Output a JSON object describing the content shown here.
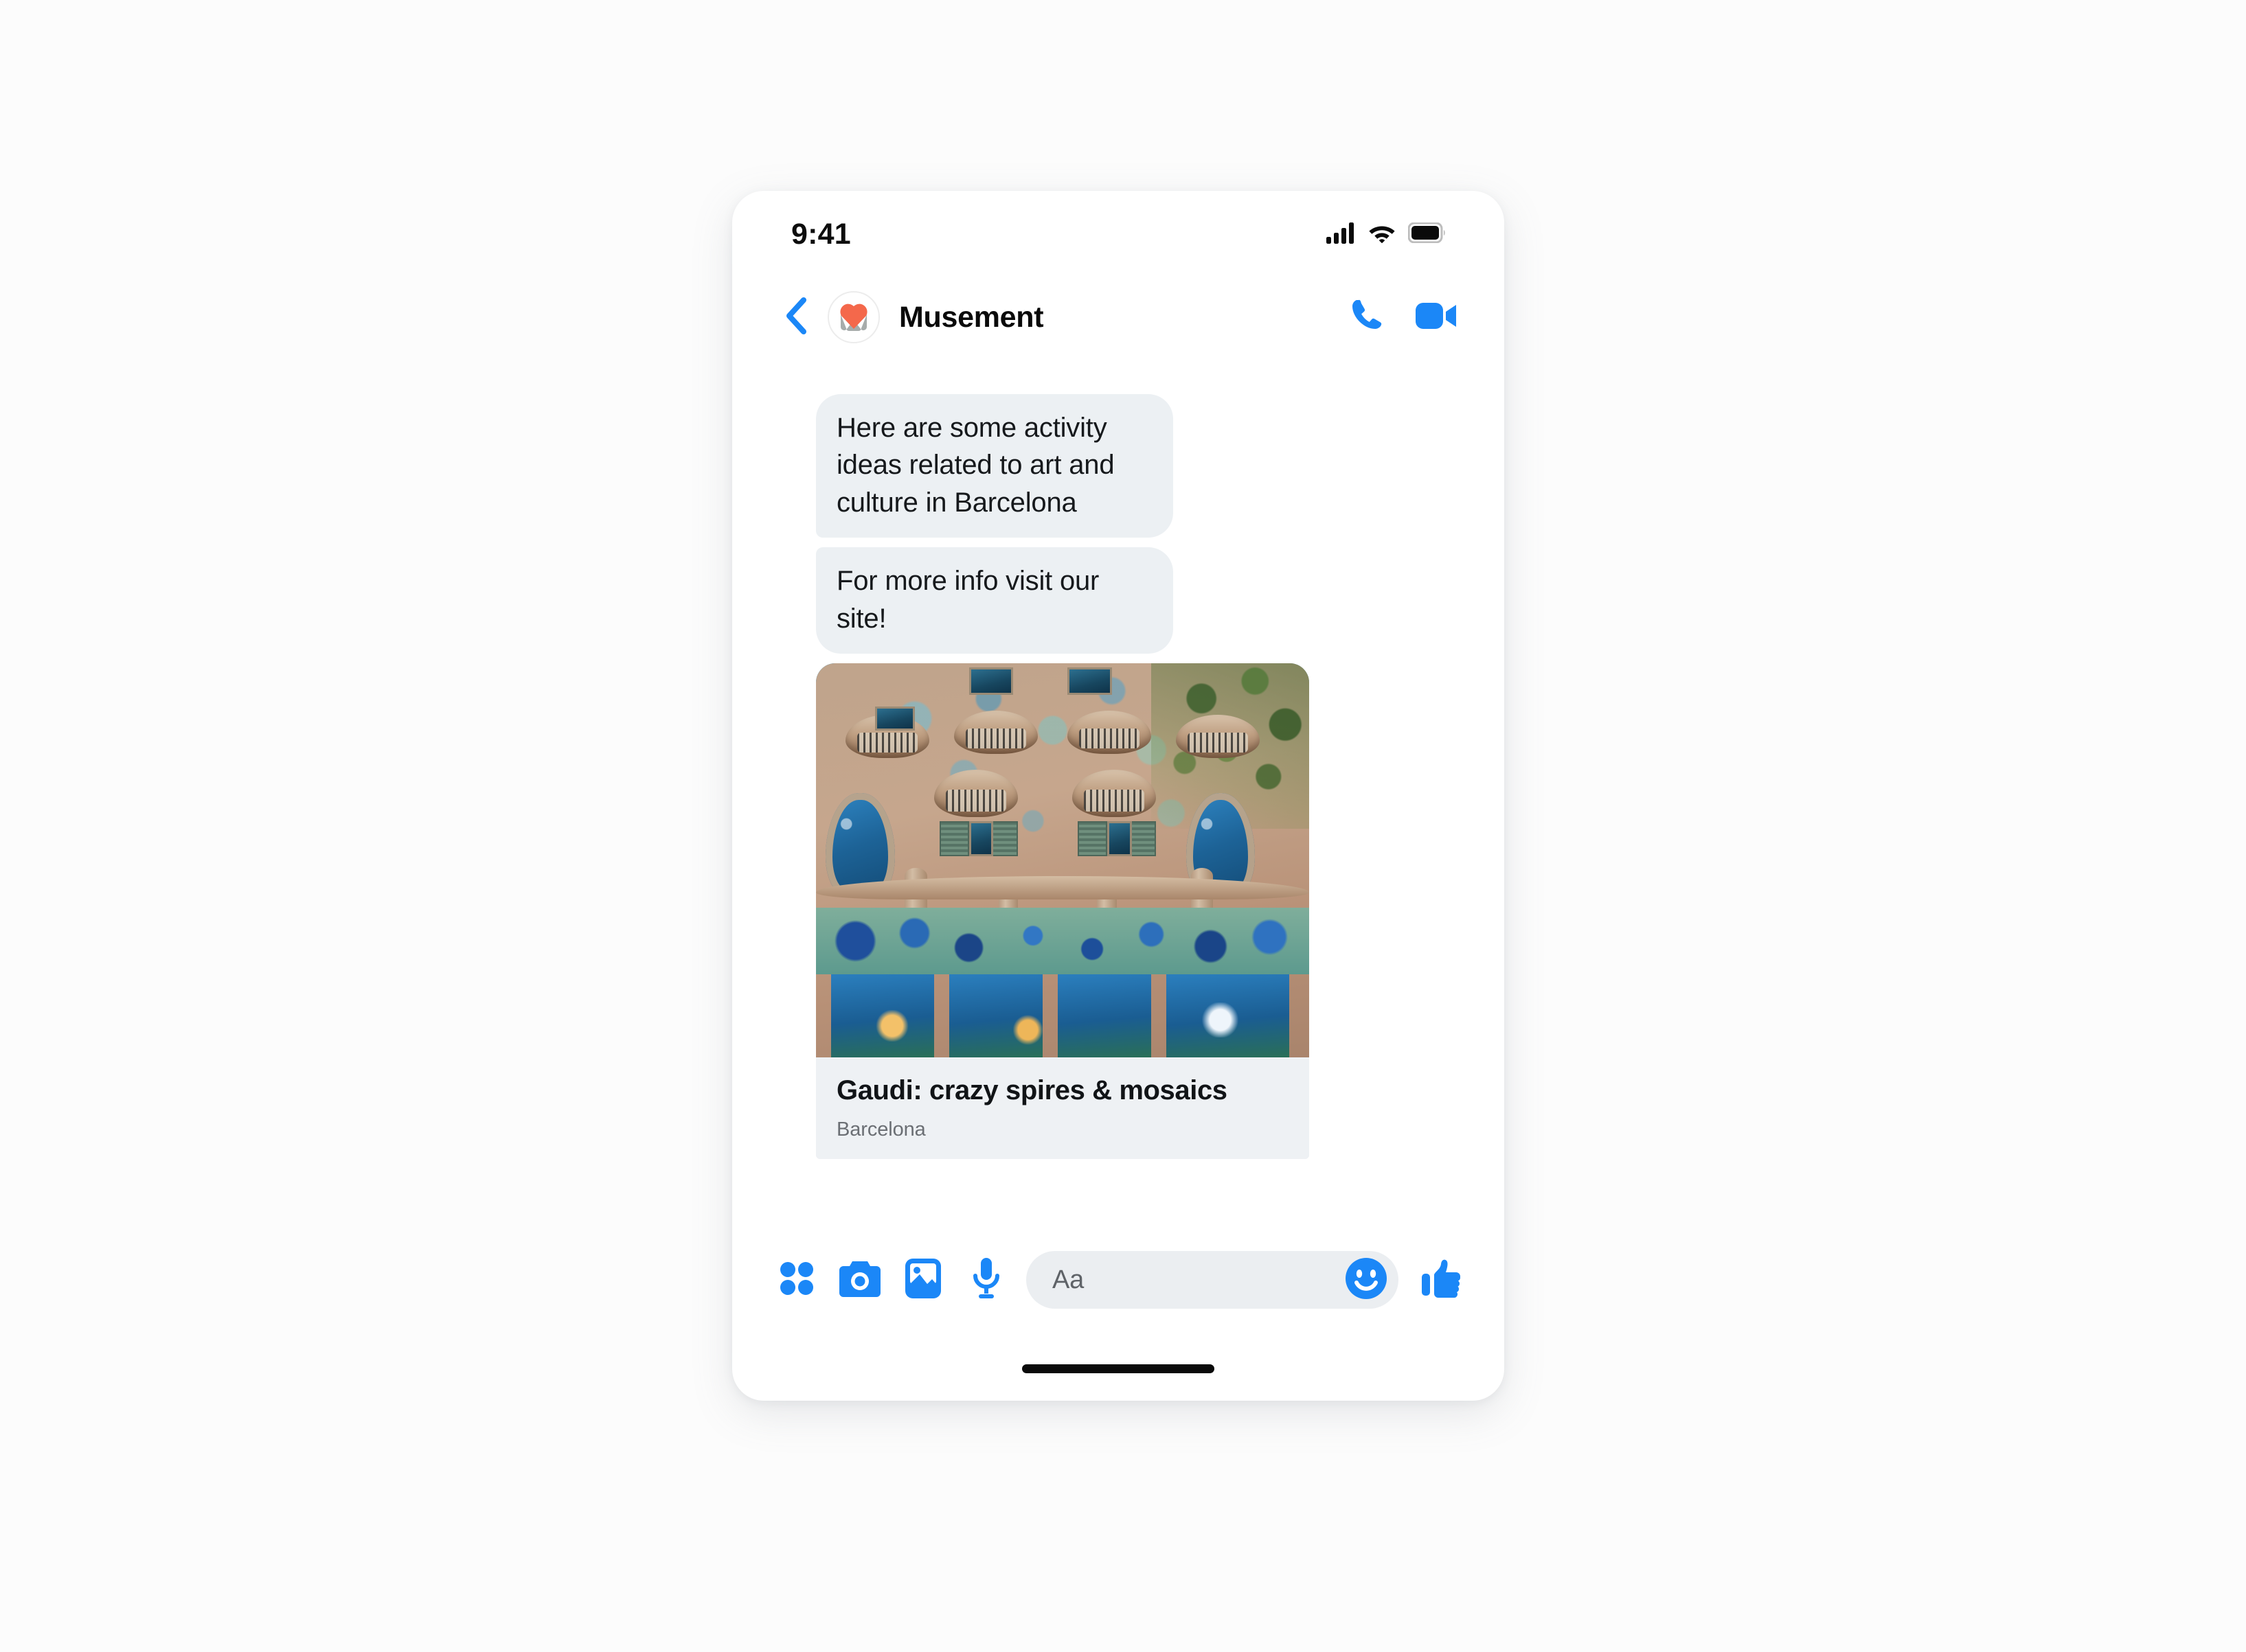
{
  "status_bar": {
    "time": "9:41",
    "signal_icon": "cellular-signal-icon",
    "wifi_icon": "wifi-icon",
    "battery_icon": "battery-full-icon"
  },
  "header": {
    "back_icon": "back-chevron-icon",
    "avatar_icon": "musement-heart-logo",
    "contact_name": "Musement",
    "call_icon": "phone-call-icon",
    "video_icon": "video-call-icon"
  },
  "messages": [
    {
      "id": "msg-1",
      "sender": "business",
      "text": "Here are some activity ideas related to art and culture in Barcelona"
    },
    {
      "id": "msg-2",
      "sender": "business",
      "text": "For more info visit our site!"
    }
  ],
  "card": {
    "media_alt": "casa-batllo-facade-photo",
    "title": "Gaudi: crazy spires & mosaics",
    "subtitle": "Barcelona"
  },
  "composer": {
    "apps_icon": "four-dot-grid-icon",
    "camera_icon": "camera-icon",
    "gallery_icon": "photo-gallery-icon",
    "mic_icon": "microphone-icon",
    "input_placeholder": "Aa",
    "emoji_icon": "smiley-face-icon",
    "like_icon": "thumbs-up-icon"
  },
  "home_indicator": "home-indicator-bar",
  "colors": {
    "accent_blue": "#1b87f7",
    "bubble_gray": "#ecf0f3",
    "logo_coral": "#f4684b",
    "logo_gray": "#a7acab",
    "text_dark": "#16191c",
    "text_muted": "#6b6f74"
  }
}
